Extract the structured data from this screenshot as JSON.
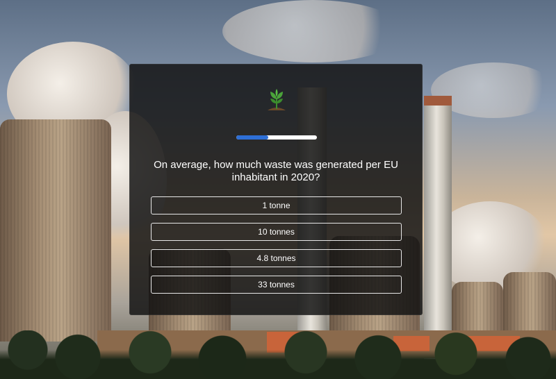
{
  "quiz": {
    "logo_icon": "sprout-icon",
    "progress": 0.4,
    "progress_color": "#2e6fd6",
    "question": "On average, how much waste was generated per EU inhabitant in 2020?",
    "answers": [
      "1 tonne",
      "10 tonnes",
      "4.8 tonnes",
      "33 tonnes"
    ]
  }
}
